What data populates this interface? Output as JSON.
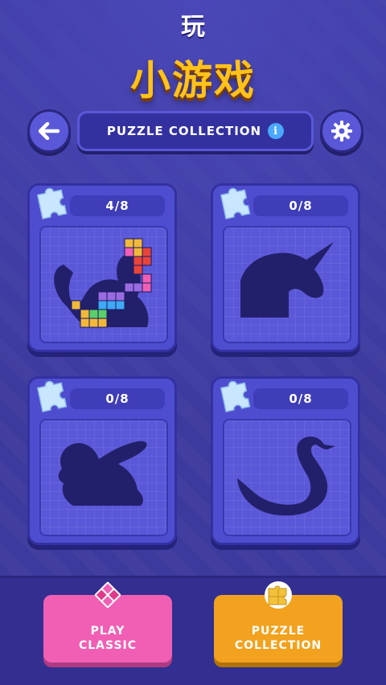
{
  "overlay": {
    "top_title": "玩",
    "app_title": "小游戏"
  },
  "header": {
    "title": "PUZZLE COLLECTION",
    "info": "i"
  },
  "puzzles": [
    {
      "progress": "4/8",
      "subject": "cat",
      "icon": "jigsaw-piece-icon"
    },
    {
      "progress": "0/8",
      "subject": "unicorn",
      "icon": "jigsaw-piece-icon"
    },
    {
      "progress": "0/8",
      "subject": "rabbit",
      "icon": "jigsaw-piece-icon"
    },
    {
      "progress": "0/8",
      "subject": "swan",
      "icon": "jigsaw-piece-icon"
    }
  ],
  "buttons": {
    "play_line1": "PLAY",
    "play_line2": "CLASSIC",
    "collection_line1": "PUZZLE",
    "collection_line2": "COLLECTION"
  },
  "colors": {
    "background": "#3d3a9e",
    "accent_yellow": "#ffc21a",
    "play_pink": "#f05fb4",
    "collection_orange": "#f2a21e",
    "silhouette": "#23206b"
  }
}
